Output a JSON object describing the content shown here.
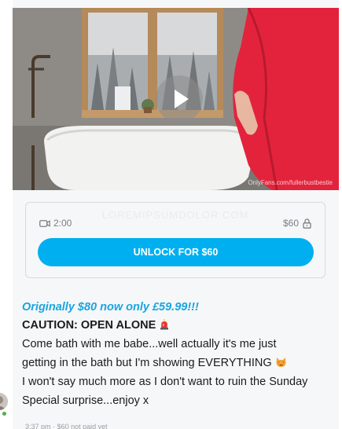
{
  "media": {
    "watermark": "OnlyFans.com/fullerbustbestie",
    "play_icon": "play-icon"
  },
  "locked": {
    "ghost_text": "LOREMIPSUMDOLOR.COM",
    "duration": "2:00",
    "price": "$60",
    "unlock_label": "UNLOCK FOR $60",
    "video_icon": "video-camera-icon",
    "lock_icon": "lock-icon"
  },
  "message": {
    "promo": "Originally $80 now only £59.99!!!",
    "caution": "CAUTION: OPEN ALONE",
    "line1": "Come bath with me babe...well actually it's me just",
    "line2": "getting in the bath but I'm showing EVERYTHING",
    "line3": "I won't say much more as I don't want to ruin the Sunday",
    "line4": "Special surprise...enjoy x"
  },
  "meta": {
    "time": "3:37 pm",
    "status": "$60 not paid yet"
  },
  "colors": {
    "accent": "#00aff0",
    "promo": "#1aa5e0",
    "online": "#4caf50"
  }
}
